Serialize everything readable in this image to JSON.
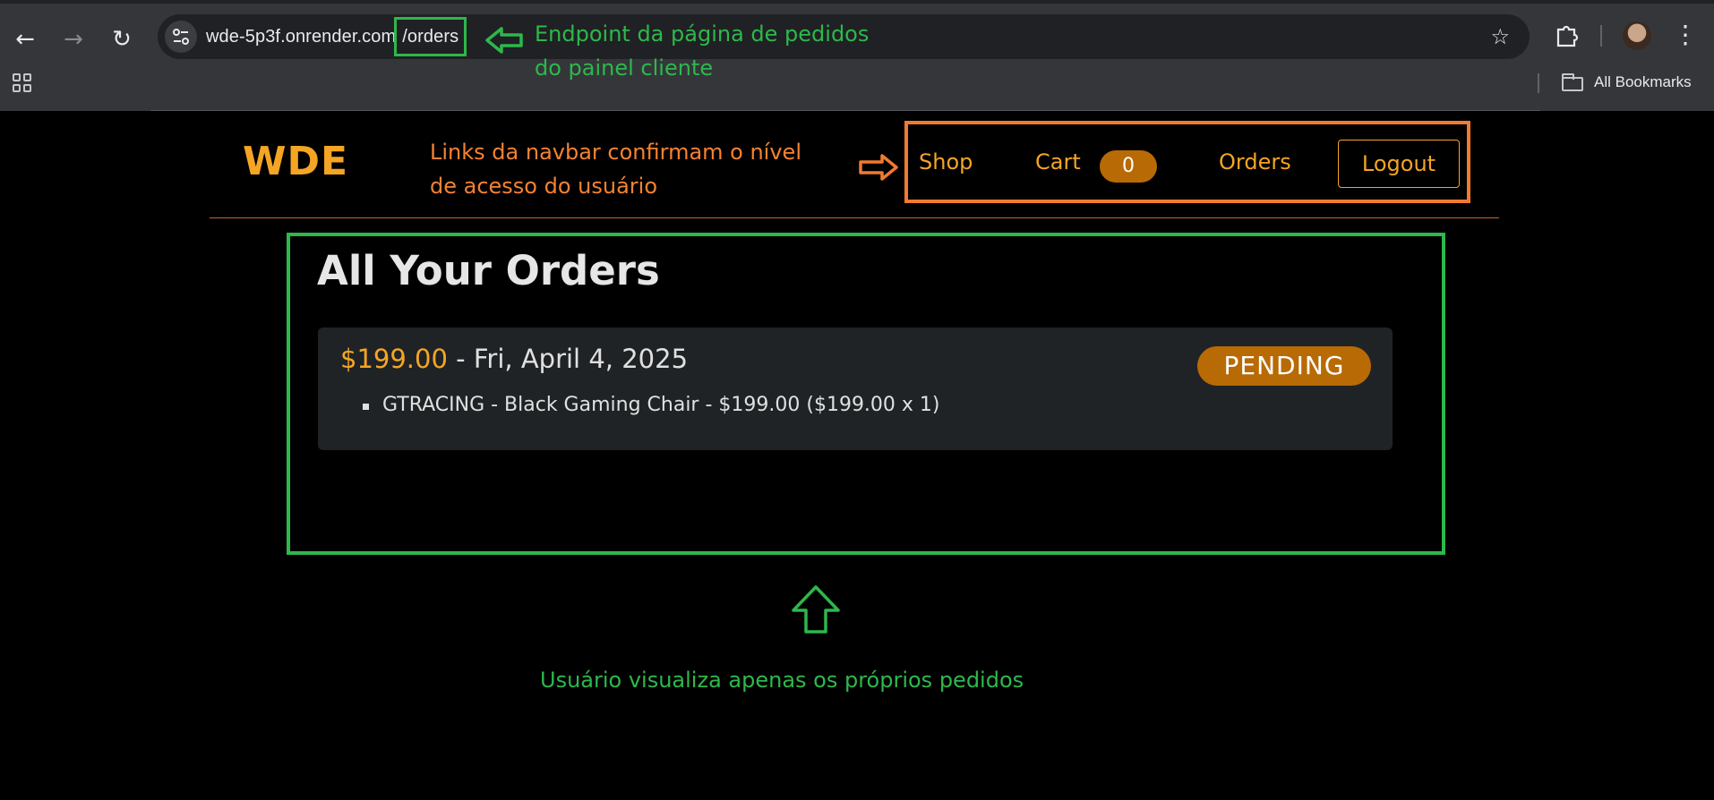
{
  "browser": {
    "url_host": "wde-5p3f.onrender.com",
    "url_path": "/orders",
    "bookmarks_label": "All Bookmarks",
    "icons": [
      "back-icon",
      "forward-icon",
      "reload-icon",
      "site-info-icon",
      "star-icon",
      "extensions-icon",
      "profile-avatar",
      "more-menu-icon",
      "apps-icon",
      "folder-icon"
    ]
  },
  "annotations": {
    "endpoint_line1": "Endpoint da página de pedidos",
    "endpoint_line2": "do painel cliente",
    "navbar_line1": "Links da navbar confirmam o nível",
    "navbar_line2": "de acesso do usuário",
    "orders_note": "Usuário visualiza apenas os próprios pedidos",
    "colors": {
      "green": "#2db84c",
      "orange": "#f07a2f"
    }
  },
  "site": {
    "logo": "WDE",
    "nav": {
      "shop": "Shop",
      "cart": "Cart",
      "cart_count": "0",
      "orders": "Orders",
      "logout": "Logout"
    },
    "accent_color": "#f5a524",
    "badge_color": "#b86a05"
  },
  "orders_page": {
    "title": "All Your Orders",
    "orders": [
      {
        "amount": "$199.00",
        "separator": " - ",
        "date": "Fri, April 4, 2025",
        "status": "PENDING",
        "items": [
          "GTRACING - Black Gaming Chair - $199.00 ($199.00 x 1)"
        ]
      }
    ]
  }
}
